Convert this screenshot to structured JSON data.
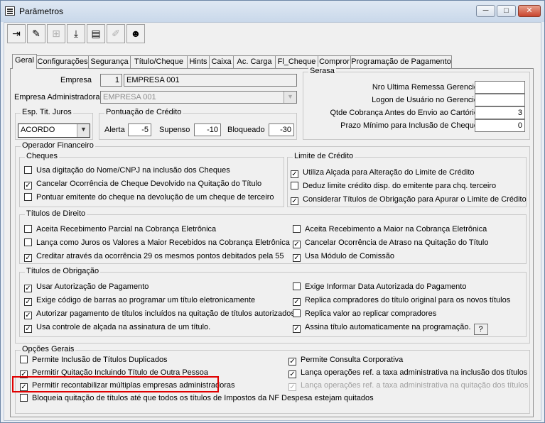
{
  "window": {
    "title": "Parâmetros",
    "min_label": "─",
    "max_label": "□",
    "close_label": "✕"
  },
  "toolbar": [
    {
      "icon": "exit-icon",
      "glyph": "⇥",
      "enabled": true
    },
    {
      "icon": "edit-icon",
      "glyph": "✎",
      "enabled": true
    },
    {
      "icon": "tree-icon",
      "glyph": "⊞",
      "enabled": false
    },
    {
      "icon": "download-icon",
      "glyph": "⤓",
      "enabled": true
    },
    {
      "icon": "save-icon",
      "glyph": "▤",
      "enabled": true
    },
    {
      "icon": "pen-disabled-icon",
      "glyph": "✐",
      "enabled": false
    },
    {
      "icon": "person-icon",
      "glyph": "☻",
      "enabled": true
    }
  ],
  "tabs": [
    "Geral",
    "Configurações",
    "Segurança",
    "Título/Cheque",
    "Hints",
    "Caixa",
    "Ac. Carga",
    "Fl_Cheque",
    "Compror",
    "Programação de Pagamento"
  ],
  "active_tab": "Geral",
  "empresa": {
    "label": "Empresa",
    "code": "1",
    "name": "EMPRESA 001"
  },
  "empresa_adm": {
    "label": "Empresa  Administradora",
    "value": "EMPRESA 001"
  },
  "esp_tit_juros": {
    "title": "Esp. Tit. Juros",
    "value": "ACORDO"
  },
  "pontuacao": {
    "title": "Pontuação de Crédito",
    "alerta_label": "Alerta",
    "alerta_value": "-5",
    "suspenso_label": "Supenso",
    "suspenso_value": "-10",
    "bloqueado_label": "Bloqueado",
    "bloqueado_value": "-30"
  },
  "serasa": {
    "title": "Serasa",
    "rows": [
      {
        "label": "Nro Ultima Remessa Gerencie",
        "value": ""
      },
      {
        "label": "Logon de Usuário no Gerencie",
        "value": ""
      },
      {
        "label": "Qtde Cobrança  Antes do Envio ao Cartório",
        "value": "3"
      },
      {
        "label": "Prazo Mínimo para Inclusão de Cheque",
        "value": "0"
      }
    ]
  },
  "operador": {
    "title": "Operador Financeiro",
    "cheques": {
      "title": "Cheques",
      "items": [
        {
          "label": "Usa digitação do Nome/CNPJ na inclusão dos Cheques",
          "checked": false
        },
        {
          "label": "Cancelar Ocorrência de Cheque Devolvido na Quitação do Título",
          "checked": true
        },
        {
          "label": "Pontuar emitente do cheque na devolução de um cheque de terceiro",
          "checked": false
        }
      ]
    },
    "limite": {
      "title": "Limite de Crédito",
      "items": [
        {
          "label": "Utiliza Alçada para Alteração do Limite de Crédito",
          "checked": true
        },
        {
          "label": "Deduz limite crédito disp. do emitente para chq. terceiro",
          "checked": false
        },
        {
          "label": "Considerar Títulos de Obrigação para Apurar o Limite de Crédito",
          "checked": true
        }
      ]
    },
    "titulos_direito": {
      "title": "Títulos de Direito",
      "left": [
        {
          "label": "Aceita Recebimento Parcial na Cobrança Eletrônica",
          "checked": false
        },
        {
          "label": "Lança como Juros os Valores a Maior Recebidos na Cobrança Eletrônica",
          "checked": false
        },
        {
          "label": "Creditar através da ocorrência 29 os mesmos pontos debitados pela 55",
          "checked": true
        }
      ],
      "right": [
        {
          "label": "Aceita Recebimento a Maior na Cobrança Eletrônica",
          "checked": false
        },
        {
          "label": "Cancelar Ocorrência de Atraso na Quitação do Título",
          "checked": true
        },
        {
          "label": "Usa Módulo de Comissão",
          "checked": true
        }
      ]
    },
    "titulos_obrigacao": {
      "title": "Títulos de Obrigação",
      "left": [
        {
          "label": "Usar Autorização de Pagamento",
          "checked": true
        },
        {
          "label": "Exige código de barras ao programar um título eletronicamente",
          "checked": true
        },
        {
          "label": "Autorizar pagamento de títulos incluídos na quitação de títulos autorizados",
          "checked": true
        },
        {
          "label": "Usa controle de alçada na assinatura de um título.",
          "checked": true
        }
      ],
      "right": [
        {
          "label": "Exige Informar Data Autorizada do Pagamento",
          "checked": false
        },
        {
          "label": "Replica compradores do título original para os novos títulos",
          "checked": true
        },
        {
          "label": "Replica valor ao replicar compradores",
          "checked": false
        },
        {
          "label": "Assina título automaticamente na programação.",
          "checked": true
        }
      ],
      "help_button": "?"
    }
  },
  "opcoes_gerais": {
    "title": "Opções Gerais",
    "left": [
      {
        "label": "Permite Inclusão de Títulos Duplicados",
        "checked": false
      },
      {
        "label": "Permitir Quitação Incluindo Título de Outra Pessoa",
        "checked": true
      },
      {
        "label": "Permitir recontabilizar múltiplas empresas administradoras",
        "checked": true
      }
    ],
    "right": [
      {
        "label": "Permite Consulta Corporativa",
        "checked": true,
        "enabled": true
      },
      {
        "label": "Lança operações ref. a taxa administrativa na inclusão dos títulos",
        "checked": true,
        "enabled": true
      },
      {
        "label": "Lança operações ref. a taxa administrativa na quitação dos títulos",
        "checked": true,
        "enabled": false
      }
    ],
    "full": {
      "label": "Bloqueia quitação de títulos até que todos os títulos de Impostos da NF Despesa estejam quitados",
      "checked": false
    }
  },
  "colors": {
    "highlight": "#e10000",
    "close_button": "#c8452e"
  }
}
